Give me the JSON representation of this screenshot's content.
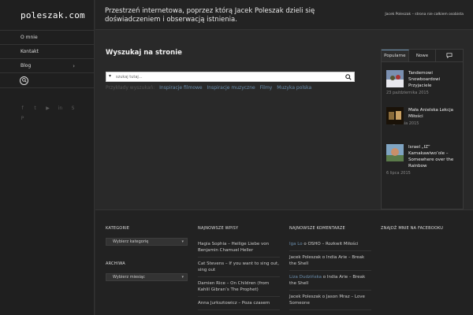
{
  "site": {
    "logo": "poleszak.com",
    "tagline": "Przestrzeń internetowa, poprzez którą Jacek Poleszak dzieli się doświadczeniem i obserwacją istnienia.",
    "header_right": "Jacek Poleszak – strona nie całkiem osobista"
  },
  "nav": {
    "items": [
      {
        "label": "O mnie"
      },
      {
        "label": "Kontakt"
      },
      {
        "label": "Blog"
      }
    ]
  },
  "social_icons": [
    "facebook-icon",
    "twitter-icon",
    "youtube-icon",
    "linkedin-icon",
    "skype-icon",
    "pinterest-icon"
  ],
  "main": {
    "title": "Wyszukaj na stronie",
    "search_placeholder": "szukaj tutaj...",
    "examples_label": "Przykłady wyszukań:",
    "examples": [
      "Inspiracje filmowe",
      "Inspiracje muzyczne",
      "Filmy",
      "Muzyka polska"
    ]
  },
  "widget": {
    "tabs": [
      "Popularne",
      "Nowe"
    ],
    "posts": [
      {
        "title": "Tandemowi Snowboardowi Przyjaciele",
        "date": "23 października 2015"
      },
      {
        "title": "Mała Anielska Lekcja Miłości",
        "date": "25 grudnia 2015"
      },
      {
        "title": "Israel „IZ” Kamakawiwo’ole – Somewhere over the Rainbow",
        "date": "6 lipca 2015"
      }
    ]
  },
  "footer": {
    "categories": {
      "heading": "KATEGORIE",
      "select": "Wybierz kategorię"
    },
    "archive": {
      "heading": "ARCHIWA",
      "select": "Wybierz miesiąc"
    },
    "recent_posts": {
      "heading": "NAJNOWSZE WPISY",
      "items": [
        "Hagia Sophia – Heilige Liebe von Benjamin Chamuel Heller",
        "Cat Stevens – If you want to sing out, sing out",
        "Damien Rice – On Children (from Kahlil Gibran’s The Prophet)",
        "Anna Jurksztowicz – Poza czasem"
      ]
    },
    "recent_comments": {
      "heading": "NAJNOWSZE KOMENTARZE",
      "items": [
        {
          "author": "Iga Lo",
          "sep": " o ",
          "post": "OSHO – Rozkwit Miłości"
        },
        {
          "author": "Jacek Poleszak",
          "sep": " o ",
          "post": "India Arie – Break the Shell"
        },
        {
          "author": "Liza Dudzińska",
          "sep": " o ",
          "post": "India Arie – Break the Shell"
        },
        {
          "author": "Jacek Poleszak",
          "sep": " o ",
          "post": "Jason Mraz – Love Someone"
        }
      ]
    },
    "facebook": {
      "heading": "ZNAJDŹ MNIE NA FACEBOOKU"
    }
  },
  "colors": {
    "accent": "#6b8fae",
    "background": "#2a2a2a"
  }
}
